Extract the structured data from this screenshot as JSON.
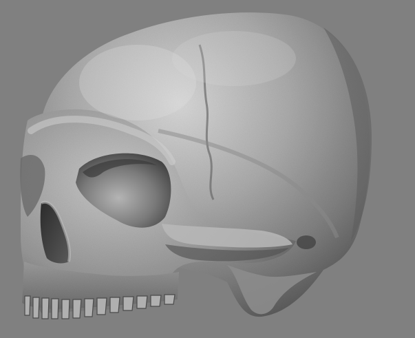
{
  "scene": {
    "subject": "skull-3d-render",
    "background_color": "#808080",
    "bone_colors": {
      "highlight": "#d2d2d2",
      "mid": "#9c9c9c",
      "shadow": "#4a4a4a",
      "deep": "#262626"
    }
  }
}
